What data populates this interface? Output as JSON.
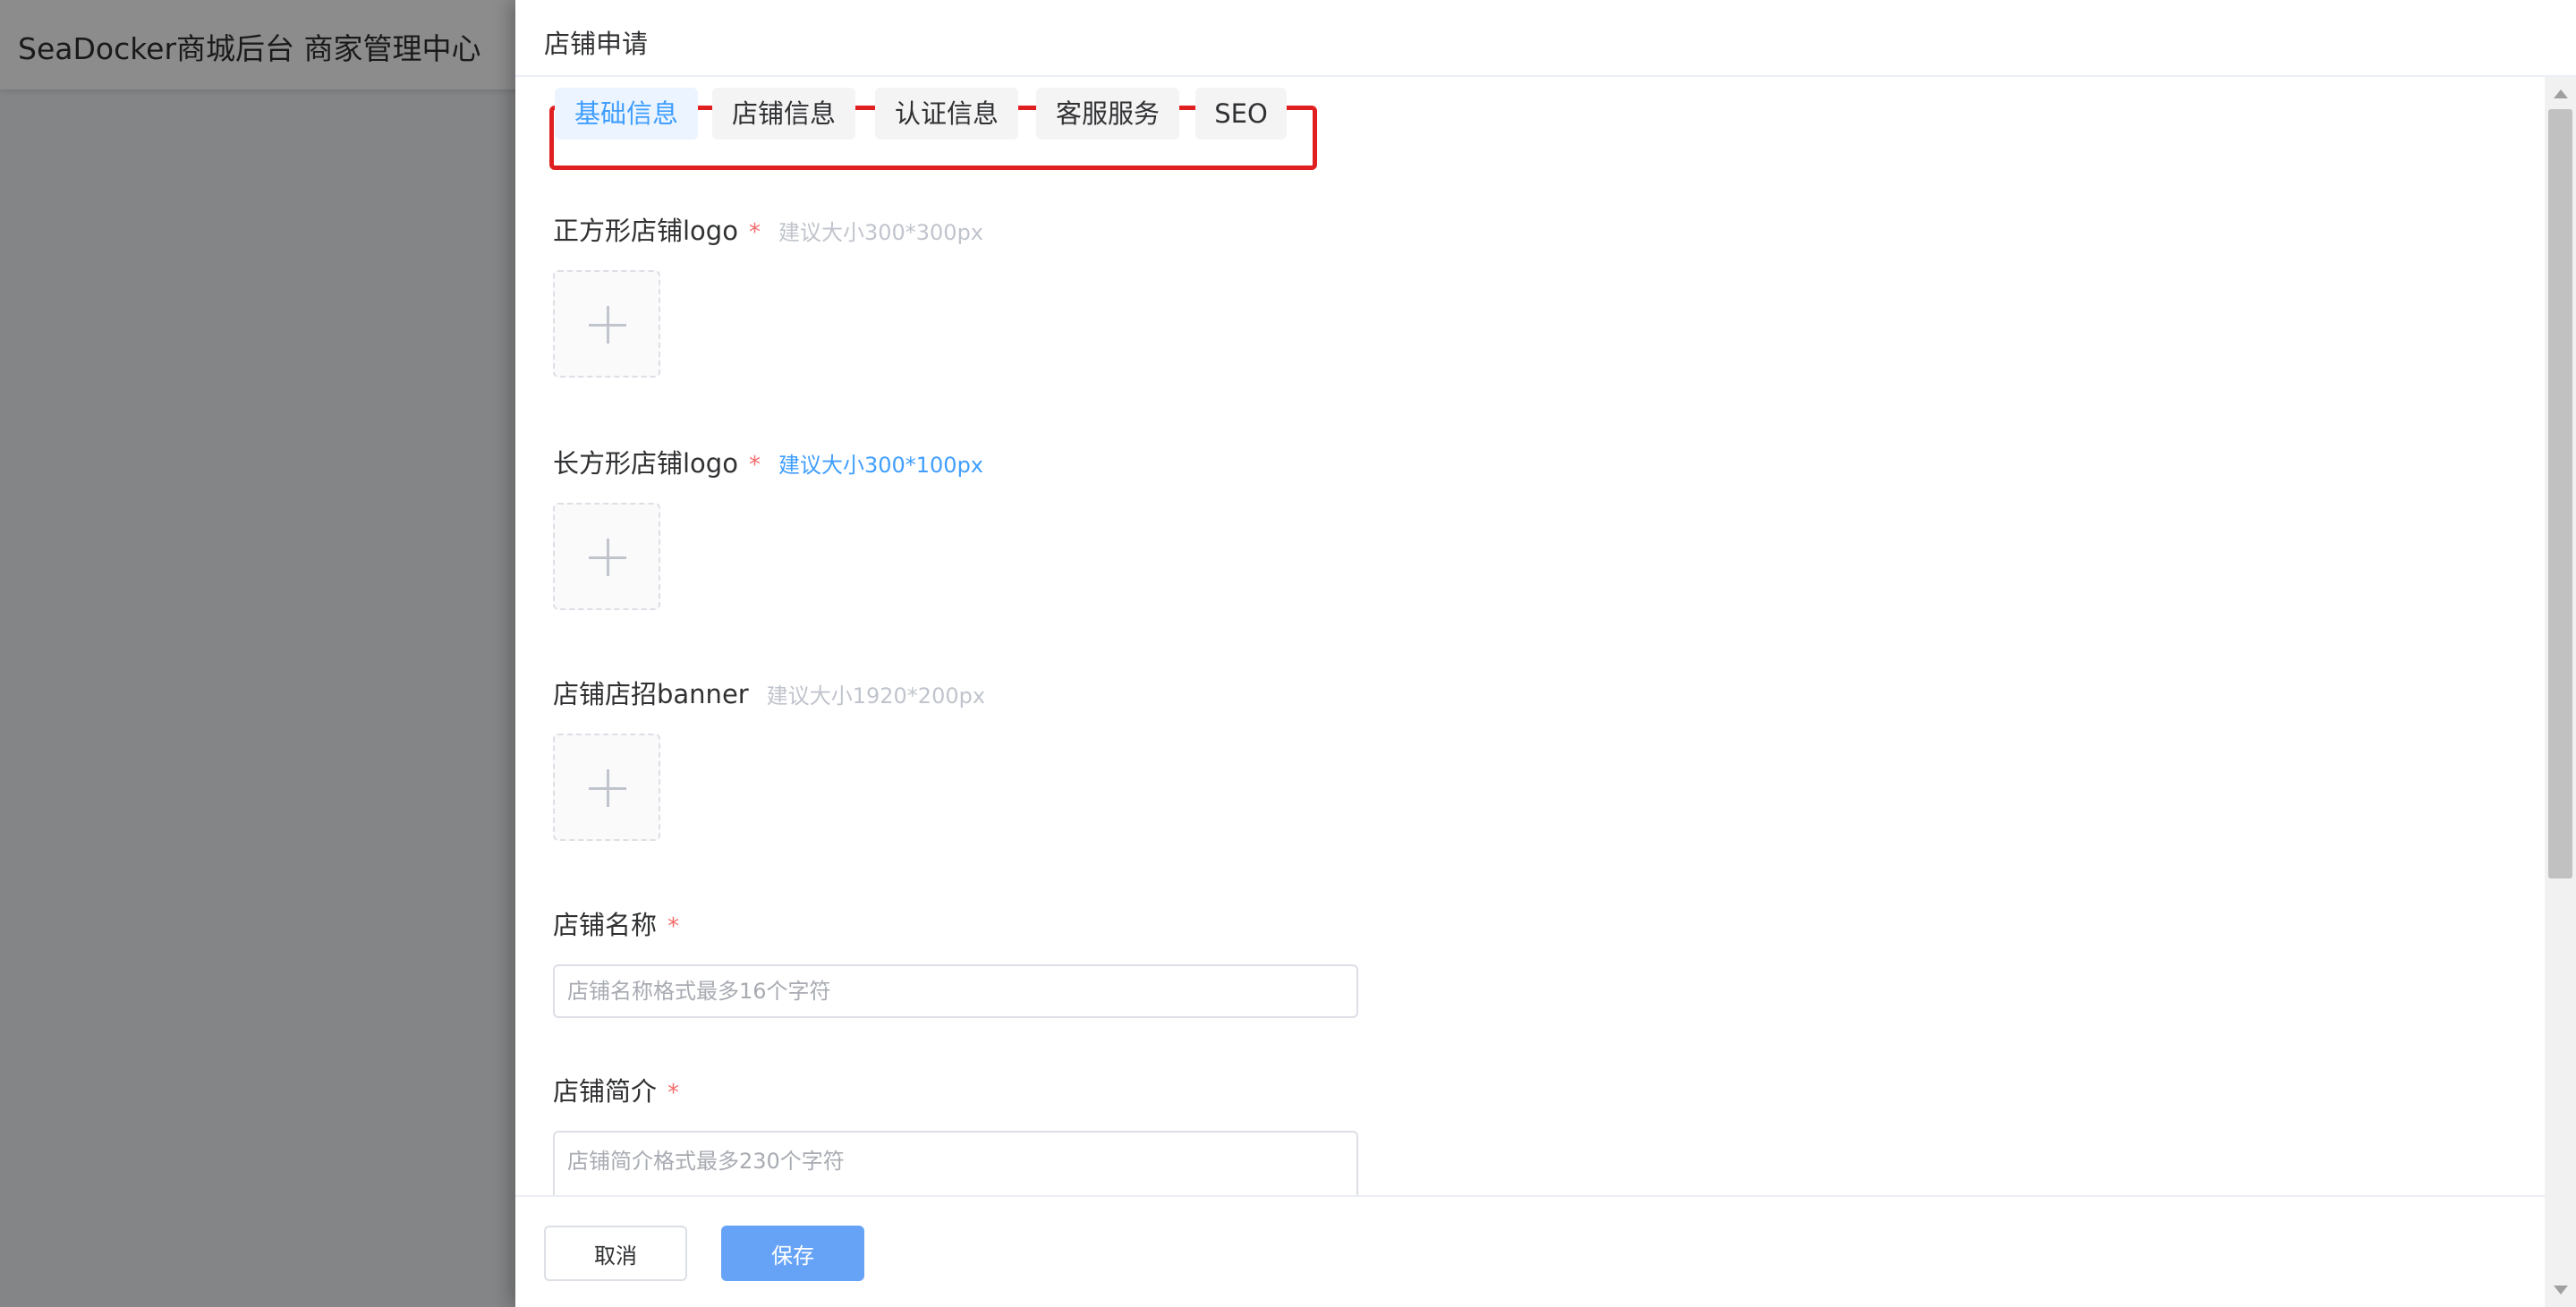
{
  "app": {
    "title": "SeaDocker商城后台 商家管理中心"
  },
  "drawer": {
    "title": "店铺申请"
  },
  "tabs": [
    {
      "label": "基础信息",
      "active": true
    },
    {
      "label": "店铺信息",
      "active": false
    },
    {
      "label": "认证信息",
      "active": false
    },
    {
      "label": "客服服务",
      "active": false
    },
    {
      "label": "SEO",
      "active": false
    }
  ],
  "form": {
    "square_logo": {
      "label": "正方形店铺logo",
      "required": "*",
      "hint": "建议大小300*300px"
    },
    "rect_logo": {
      "label": "长方形店铺logo",
      "required": "*",
      "hint": "建议大小300*100px"
    },
    "banner": {
      "label": "店铺店招banner",
      "hint": "建议大小1920*200px"
    },
    "shop_name": {
      "label": "店铺名称",
      "required": "*",
      "placeholder": "店铺名称格式最多16个字符",
      "value": ""
    },
    "shop_intro": {
      "label": "店铺简介",
      "required": "*",
      "placeholder": "店铺简介格式最多230个字符",
      "value": ""
    }
  },
  "footer": {
    "cancel_label": "取消",
    "save_label": "保存"
  },
  "colors": {
    "accent": "#409eff",
    "primary_button": "#66a3f6",
    "required": "#f56c6c",
    "highlight_frame": "#e02020"
  },
  "icons": {
    "upload": "plus-icon",
    "scroll_up": "arrow-up-icon",
    "scroll_down": "arrow-down-icon"
  }
}
